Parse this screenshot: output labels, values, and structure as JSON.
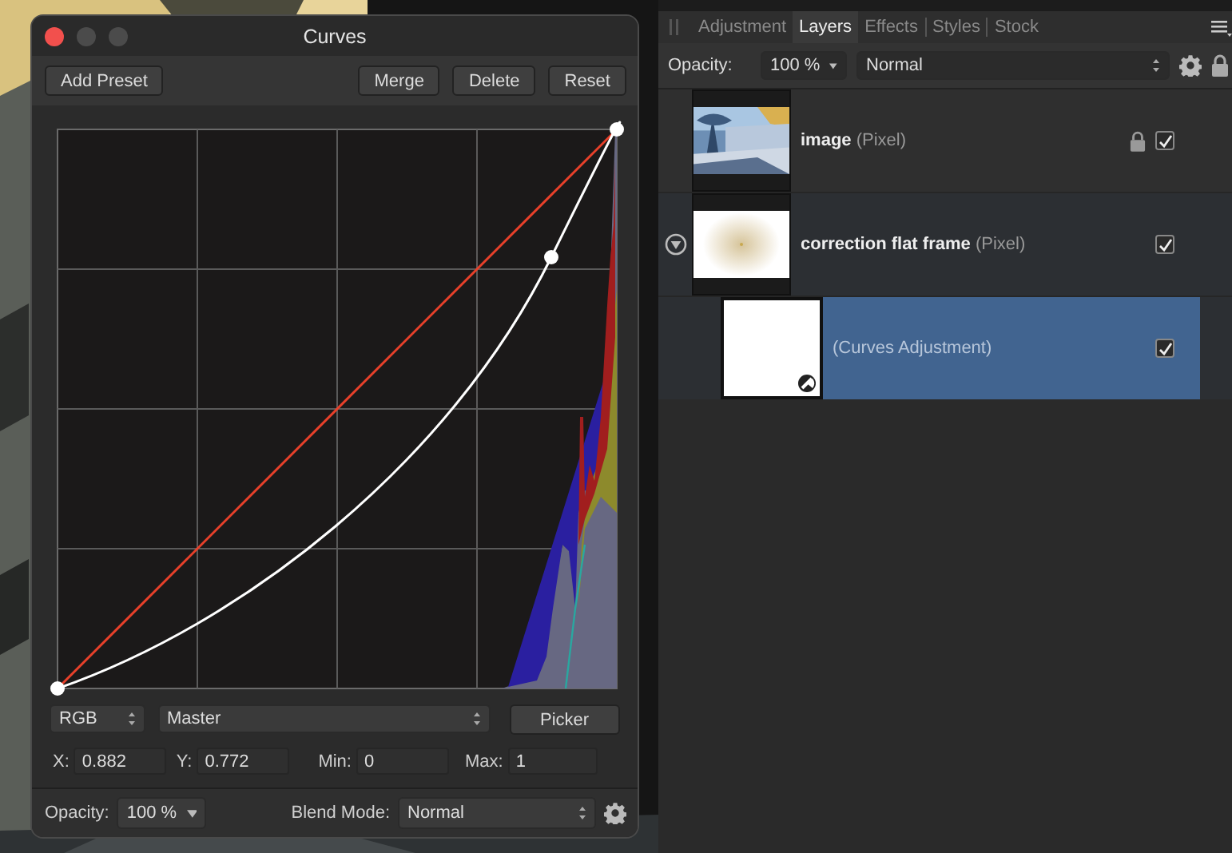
{
  "dialog": {
    "title": "Curves",
    "left_buttons": [
      "Add Preset"
    ],
    "right_buttons": [
      "Merge",
      "Delete",
      "Reset"
    ],
    "color_model": "RGB",
    "channel": "Master",
    "picker_button": "Picker",
    "fields": [
      {
        "label": "X:",
        "value": "0.882"
      },
      {
        "label": "Y:",
        "value": "0.772"
      },
      {
        "label": "Min:",
        "value": "0"
      },
      {
        "label": "Max:",
        "value": "1"
      }
    ],
    "opacity_label": "Opacity:",
    "opacity": "100 %",
    "blend_label": "Blend Mode:",
    "blend": "Normal"
  },
  "panel": {
    "tabs": [
      {
        "label": "Adjustment",
        "selected": false
      },
      {
        "label": "Layers",
        "selected": true
      },
      {
        "label": "Effects",
        "selected": false
      },
      {
        "label": "Styles",
        "selected": false
      },
      {
        "label": "Stock",
        "selected": false
      }
    ],
    "opacity_label": "Opacity:",
    "opacity": "100 %",
    "blend": "Normal",
    "layers": [
      {
        "name": "image",
        "type": "(Pixel)",
        "locked": true,
        "visible": true,
        "selected": false
      },
      {
        "name": "correction flat frame",
        "type": "(Pixel)",
        "kind": "flat",
        "locked": false,
        "visible": true,
        "selected": false,
        "expanded": true,
        "children": [
          {
            "type": "(Curves Adjustment)",
            "kind": "adjustment",
            "locked": false,
            "visible": true,
            "selected": true
          }
        ]
      }
    ]
  }
}
